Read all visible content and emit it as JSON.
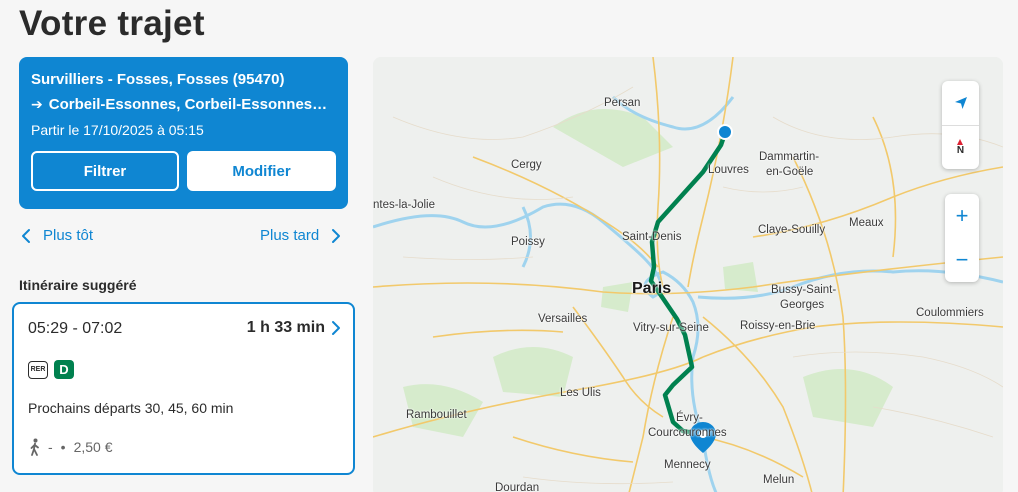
{
  "page": {
    "title": "Votre trajet"
  },
  "trip": {
    "from": "Survilliers - Fosses, Fosses (95470)",
    "to": "Corbeil-Essonnes, Corbeil-Essonnes…",
    "date": "Partir le 17/10/2025 à 05:15",
    "filter_label": "Filtrer",
    "modify_label": "Modifier"
  },
  "nav": {
    "earlier": "Plus tôt",
    "later": "Plus tard"
  },
  "section": {
    "title": "Itinéraire suggéré"
  },
  "route": {
    "time": "05:29 - 07:02",
    "duration": "1 h 33 min",
    "mode_badge": "RER",
    "line": "D",
    "next_departures": "Prochains départs 30, 45, 60 min",
    "walk": "-",
    "bullet": "•",
    "price": "2,50 €"
  },
  "map": {
    "labels": {
      "persan": "Persan",
      "cergy": "Cergy",
      "louvres": "Louvres",
      "dammartin": "Dammartin-",
      "dammartin2": "en-Goële",
      "conflans": "ntes-la-Jolie",
      "meaux": "Meaux",
      "claye": "Claye-Souilly",
      "poissy": "Poissy",
      "saintdenis": "Saint-Denis",
      "paris": "Paris",
      "bussy": "Bussy-Saint-",
      "bussy2": "Georges",
      "coulommiers": "Coulommiers",
      "versailles": "Versailles",
      "vitry": "Vitry-sur-Seine",
      "roissy": "Roissy-en-Brie",
      "lesulis": "Les Ulis",
      "rambouillet": "Rambouillet",
      "evry": "Évry-",
      "courcouronnes": "Courcouronnes",
      "mennecy": "Mennecy",
      "dourdan": "Dourdan",
      "melun": "Melun"
    },
    "north_label": "N",
    "zoom_in": "+",
    "zoom_out": "−",
    "colors": {
      "route": "#00814f",
      "water": "#9fd3ee",
      "road": "#f2c96b",
      "park": "#cfe6c3"
    }
  }
}
